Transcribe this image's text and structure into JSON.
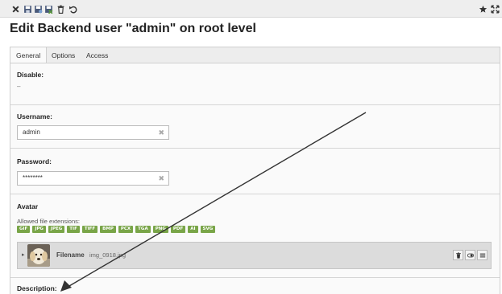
{
  "toolbar": {
    "icons": [
      "close-icon",
      "save-icon",
      "save-and-view-icon",
      "save-and-close-icon",
      "delete-icon",
      "undo-icon",
      "bookmark-star-icon",
      "fullscreen-icon"
    ]
  },
  "page": {
    "title": "Edit Backend user \"admin\" on root level"
  },
  "tabs": [
    {
      "label": "General",
      "active": true
    },
    {
      "label": "Options",
      "active": false
    },
    {
      "label": "Access",
      "active": false
    }
  ],
  "form": {
    "disable": {
      "label": "Disable:",
      "value": "–"
    },
    "username": {
      "label": "Username:",
      "value": "admin"
    },
    "password": {
      "label": "Password:",
      "value": "********"
    },
    "avatar": {
      "label": "Avatar",
      "allowed_caption": "Allowed file extensions:",
      "extensions": [
        "GIF",
        "JPG",
        "JPEG",
        "TIF",
        "TIFF",
        "BMP",
        "PCX",
        "TGA",
        "PNG",
        "PDF",
        "AI",
        "SVG"
      ],
      "file": {
        "label": "Filename",
        "name": "img_0918.jpg"
      },
      "badge_color": "#79a548"
    },
    "description": {
      "label": "Description:"
    }
  }
}
